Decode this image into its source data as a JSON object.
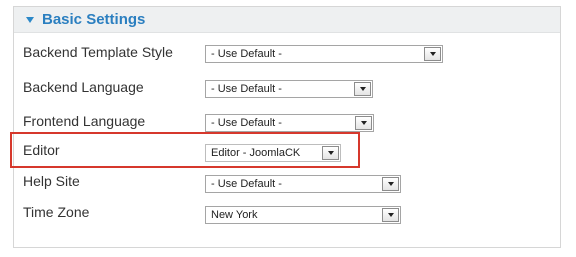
{
  "section": {
    "title": "Basic Settings"
  },
  "rows": [
    {
      "label": "Backend Template Style",
      "value": "- Use Default -"
    },
    {
      "label": "Backend Language",
      "value": "- Use Default -"
    },
    {
      "label": "Frontend Language",
      "value": "- Use Default -"
    },
    {
      "label": "Editor",
      "value": "Editor - JoomlaCK"
    },
    {
      "label": "Help Site",
      "value": "- Use Default -"
    },
    {
      "label": "Time Zone",
      "value": "New York"
    }
  ],
  "colors": {
    "header_text": "#2b7fc0",
    "highlight": "#d6382c"
  }
}
